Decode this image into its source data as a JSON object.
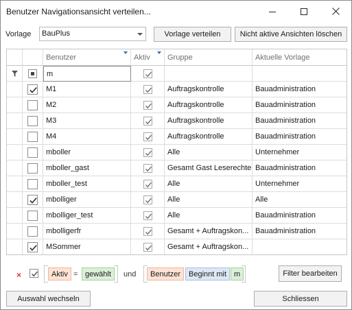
{
  "window": {
    "title": "Benutzer Navigationsansicht verteilen..."
  },
  "toolbar": {
    "vorlage_label": "Vorlage",
    "vorlage_value": "BauPlus",
    "verteilen_label": "Vorlage verteilen",
    "loeschen_label": "Nicht aktive Ansichten löschen"
  },
  "grid": {
    "columns": {
      "benutzer": "Benutzer",
      "aktiv": "Aktiv",
      "gruppe": "Gruppe",
      "vorlage": "Aktuelle Vorlage"
    },
    "filter_row": {
      "benutzer": "m",
      "aktiv_checked": true
    },
    "rows": [
      {
        "selected": true,
        "benutzer": "M1",
        "aktiv": true,
        "gruppe": "Auftragskontrolle",
        "vorlage": "Bauadministration"
      },
      {
        "selected": false,
        "benutzer": "M2",
        "aktiv": true,
        "gruppe": "Auftragskontrolle",
        "vorlage": "Bauadministration"
      },
      {
        "selected": false,
        "benutzer": "M3",
        "aktiv": true,
        "gruppe": "Auftragskontrolle",
        "vorlage": "Bauadministration"
      },
      {
        "selected": false,
        "benutzer": "M4",
        "aktiv": true,
        "gruppe": "Auftragskontrolle",
        "vorlage": "Bauadministration"
      },
      {
        "selected": false,
        "benutzer": "mboller",
        "aktiv": true,
        "gruppe": "Alle",
        "vorlage": "Unternehmer"
      },
      {
        "selected": false,
        "benutzer": "mboller_gast",
        "aktiv": true,
        "gruppe": "Gesamt Gast Leserechte",
        "vorlage": "Bauadministration"
      },
      {
        "selected": false,
        "benutzer": "mboller_test",
        "aktiv": true,
        "gruppe": "Alle",
        "vorlage": "Unternehmer"
      },
      {
        "selected": true,
        "benutzer": "mbolliger",
        "aktiv": true,
        "gruppe": "Alle",
        "vorlage": "Alle"
      },
      {
        "selected": false,
        "benutzer": "mbolliger_test",
        "aktiv": true,
        "gruppe": "Alle",
        "vorlage": "Bauadministration"
      },
      {
        "selected": false,
        "benutzer": "mbolligerfr",
        "aktiv": true,
        "gruppe": "Gesamt + Auftragskon...",
        "vorlage": "Bauadministration"
      },
      {
        "selected": true,
        "benutzer": "MSommer",
        "aktiv": true,
        "gruppe": "Gesamt + Auftragskon...",
        "vorlage": ""
      }
    ]
  },
  "filterbar": {
    "clear_glyph": "×",
    "field1": "Aktiv",
    "op1": "=",
    "value1": "gewählt",
    "conjunction": "und",
    "field2": "Benutzer",
    "op2": "Beginnt mit",
    "value2": "m",
    "edit_label": "Filter bearbeiten"
  },
  "footer": {
    "auswahl_label": "Auswahl wechseln",
    "schliessen_label": "Schliessen"
  },
  "icons": {
    "filter": "filter-icon",
    "checkmark": "checkmark-icon"
  }
}
